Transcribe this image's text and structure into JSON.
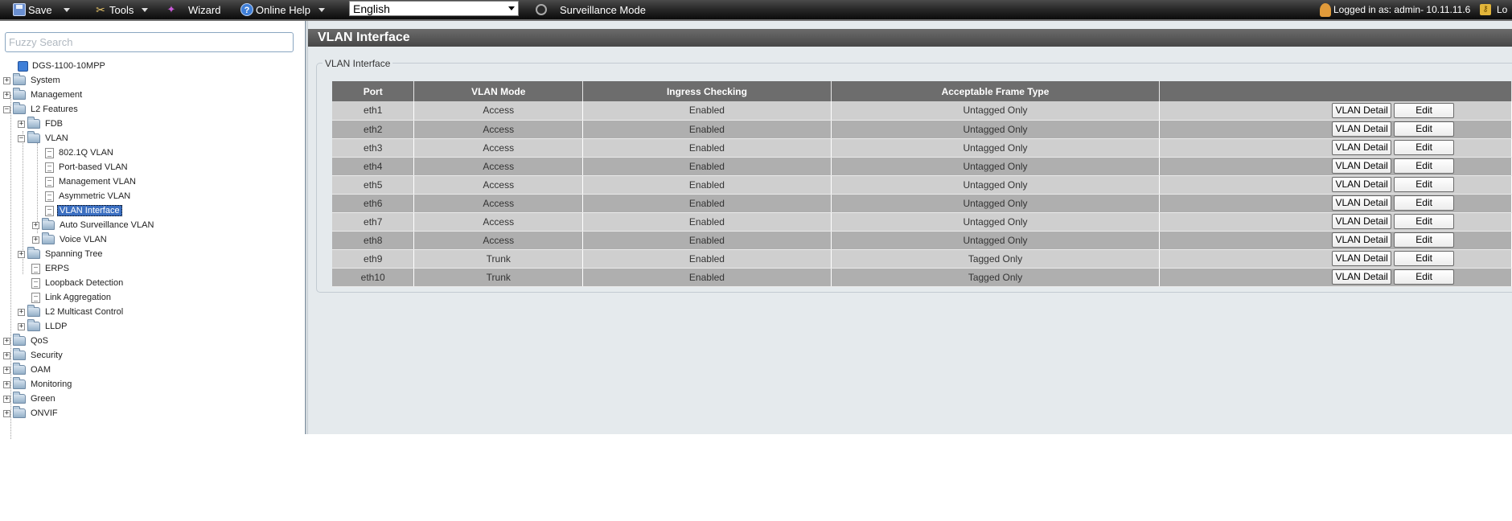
{
  "toolbar": {
    "save": "Save",
    "tools": "Tools",
    "wizard": "Wizard",
    "help": "Online Help",
    "language": "English",
    "surveillance": "Surveillance Mode",
    "logged_in": "Logged in as: admin- 10.11.11.6",
    "logout": "Lo"
  },
  "sidebar": {
    "search_placeholder": "Fuzzy Search",
    "device": "DGS-1100-10MPP",
    "items": {
      "system": "System",
      "management": "Management",
      "l2features": "L2 Features",
      "fdb": "FDB",
      "vlan": "VLAN",
      "vlan_8021q": "802.1Q VLAN",
      "vlan_port": "Port-based VLAN",
      "vlan_mgmt": "Management VLAN",
      "vlan_asym": "Asymmetric VLAN",
      "vlan_iface": "VLAN Interface",
      "auto_surv": "Auto Surveillance VLAN",
      "voice": "Voice VLAN",
      "stp": "Spanning Tree",
      "erps": "ERPS",
      "loopback": "Loopback Detection",
      "linkagg": "Link Aggregation",
      "l2mc": "L2 Multicast Control",
      "lldp": "LLDP",
      "qos": "QoS",
      "security": "Security",
      "oam": "OAM",
      "monitoring": "Monitoring",
      "green": "Green",
      "onvif": "ONVIF"
    }
  },
  "main": {
    "title": "VLAN Interface",
    "legend": "VLAN Interface",
    "columns": [
      "Port",
      "VLAN Mode",
      "Ingress Checking",
      "Acceptable Frame Type",
      ""
    ],
    "detail_label": "VLAN Detail",
    "edit_label": "Edit",
    "rows": [
      {
        "port": "eth1",
        "mode": "Access",
        "ingress": "Enabled",
        "frame": "Untagged Only"
      },
      {
        "port": "eth2",
        "mode": "Access",
        "ingress": "Enabled",
        "frame": "Untagged Only"
      },
      {
        "port": "eth3",
        "mode": "Access",
        "ingress": "Enabled",
        "frame": "Untagged Only"
      },
      {
        "port": "eth4",
        "mode": "Access",
        "ingress": "Enabled",
        "frame": "Untagged Only"
      },
      {
        "port": "eth5",
        "mode": "Access",
        "ingress": "Enabled",
        "frame": "Untagged Only"
      },
      {
        "port": "eth6",
        "mode": "Access",
        "ingress": "Enabled",
        "frame": "Untagged Only"
      },
      {
        "port": "eth7",
        "mode": "Access",
        "ingress": "Enabled",
        "frame": "Untagged Only"
      },
      {
        "port": "eth8",
        "mode": "Access",
        "ingress": "Enabled",
        "frame": "Untagged Only"
      },
      {
        "port": "eth9",
        "mode": "Trunk",
        "ingress": "Enabled",
        "frame": "Tagged Only"
      },
      {
        "port": "eth10",
        "mode": "Trunk",
        "ingress": "Enabled",
        "frame": "Tagged Only"
      }
    ]
  }
}
